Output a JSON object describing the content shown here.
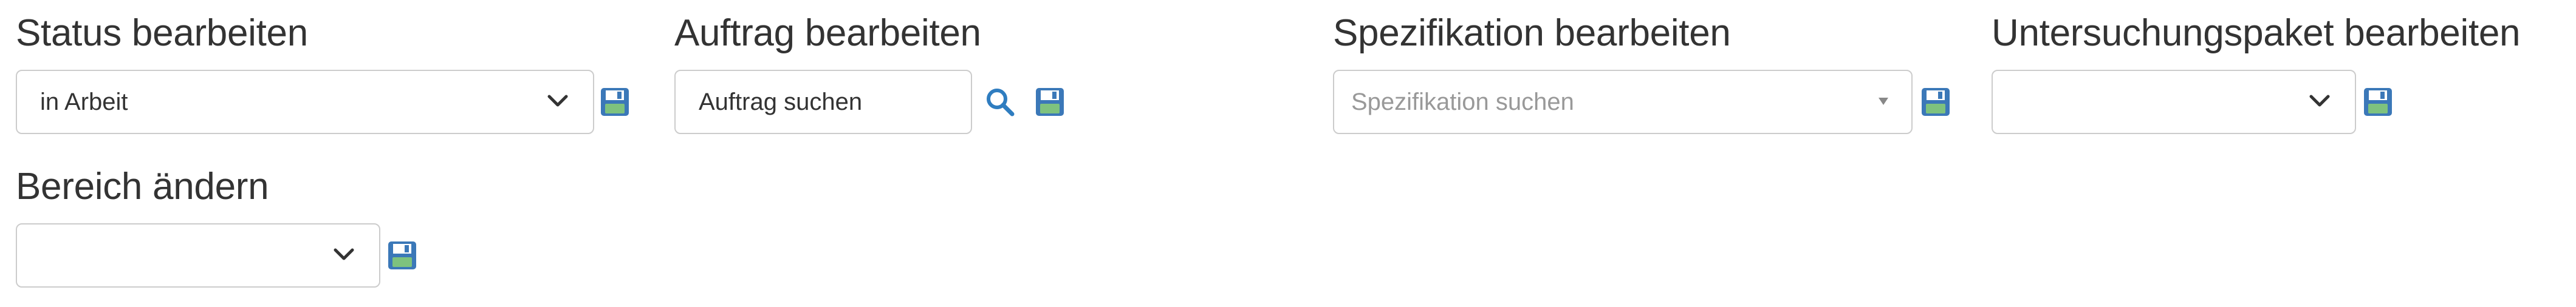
{
  "status": {
    "title": "Status bearbeiten",
    "selected": "in Arbeit"
  },
  "order": {
    "title": "Auftrag bearbeiten",
    "placeholder": "Auftrag suchen"
  },
  "specification": {
    "title": "Spezifikation bearbeiten",
    "placeholder": "Spezifikation suchen"
  },
  "package": {
    "title": "Untersuchungspaket bearbeiten",
    "selected": ""
  },
  "area": {
    "title": "Bereich ändern",
    "selected": ""
  },
  "icons": {
    "save": "floppy-disk-save-icon",
    "search": "magnifier-search-icon",
    "chevron": "chevron-down-icon",
    "caret": "caret-down-icon"
  },
  "colors": {
    "save_icon_blue": "#3b78b8",
    "save_icon_green": "#7ec27e",
    "search_icon": "#2f7dc0",
    "text": "#333333",
    "placeholder": "#999999",
    "border": "#cccccc"
  }
}
